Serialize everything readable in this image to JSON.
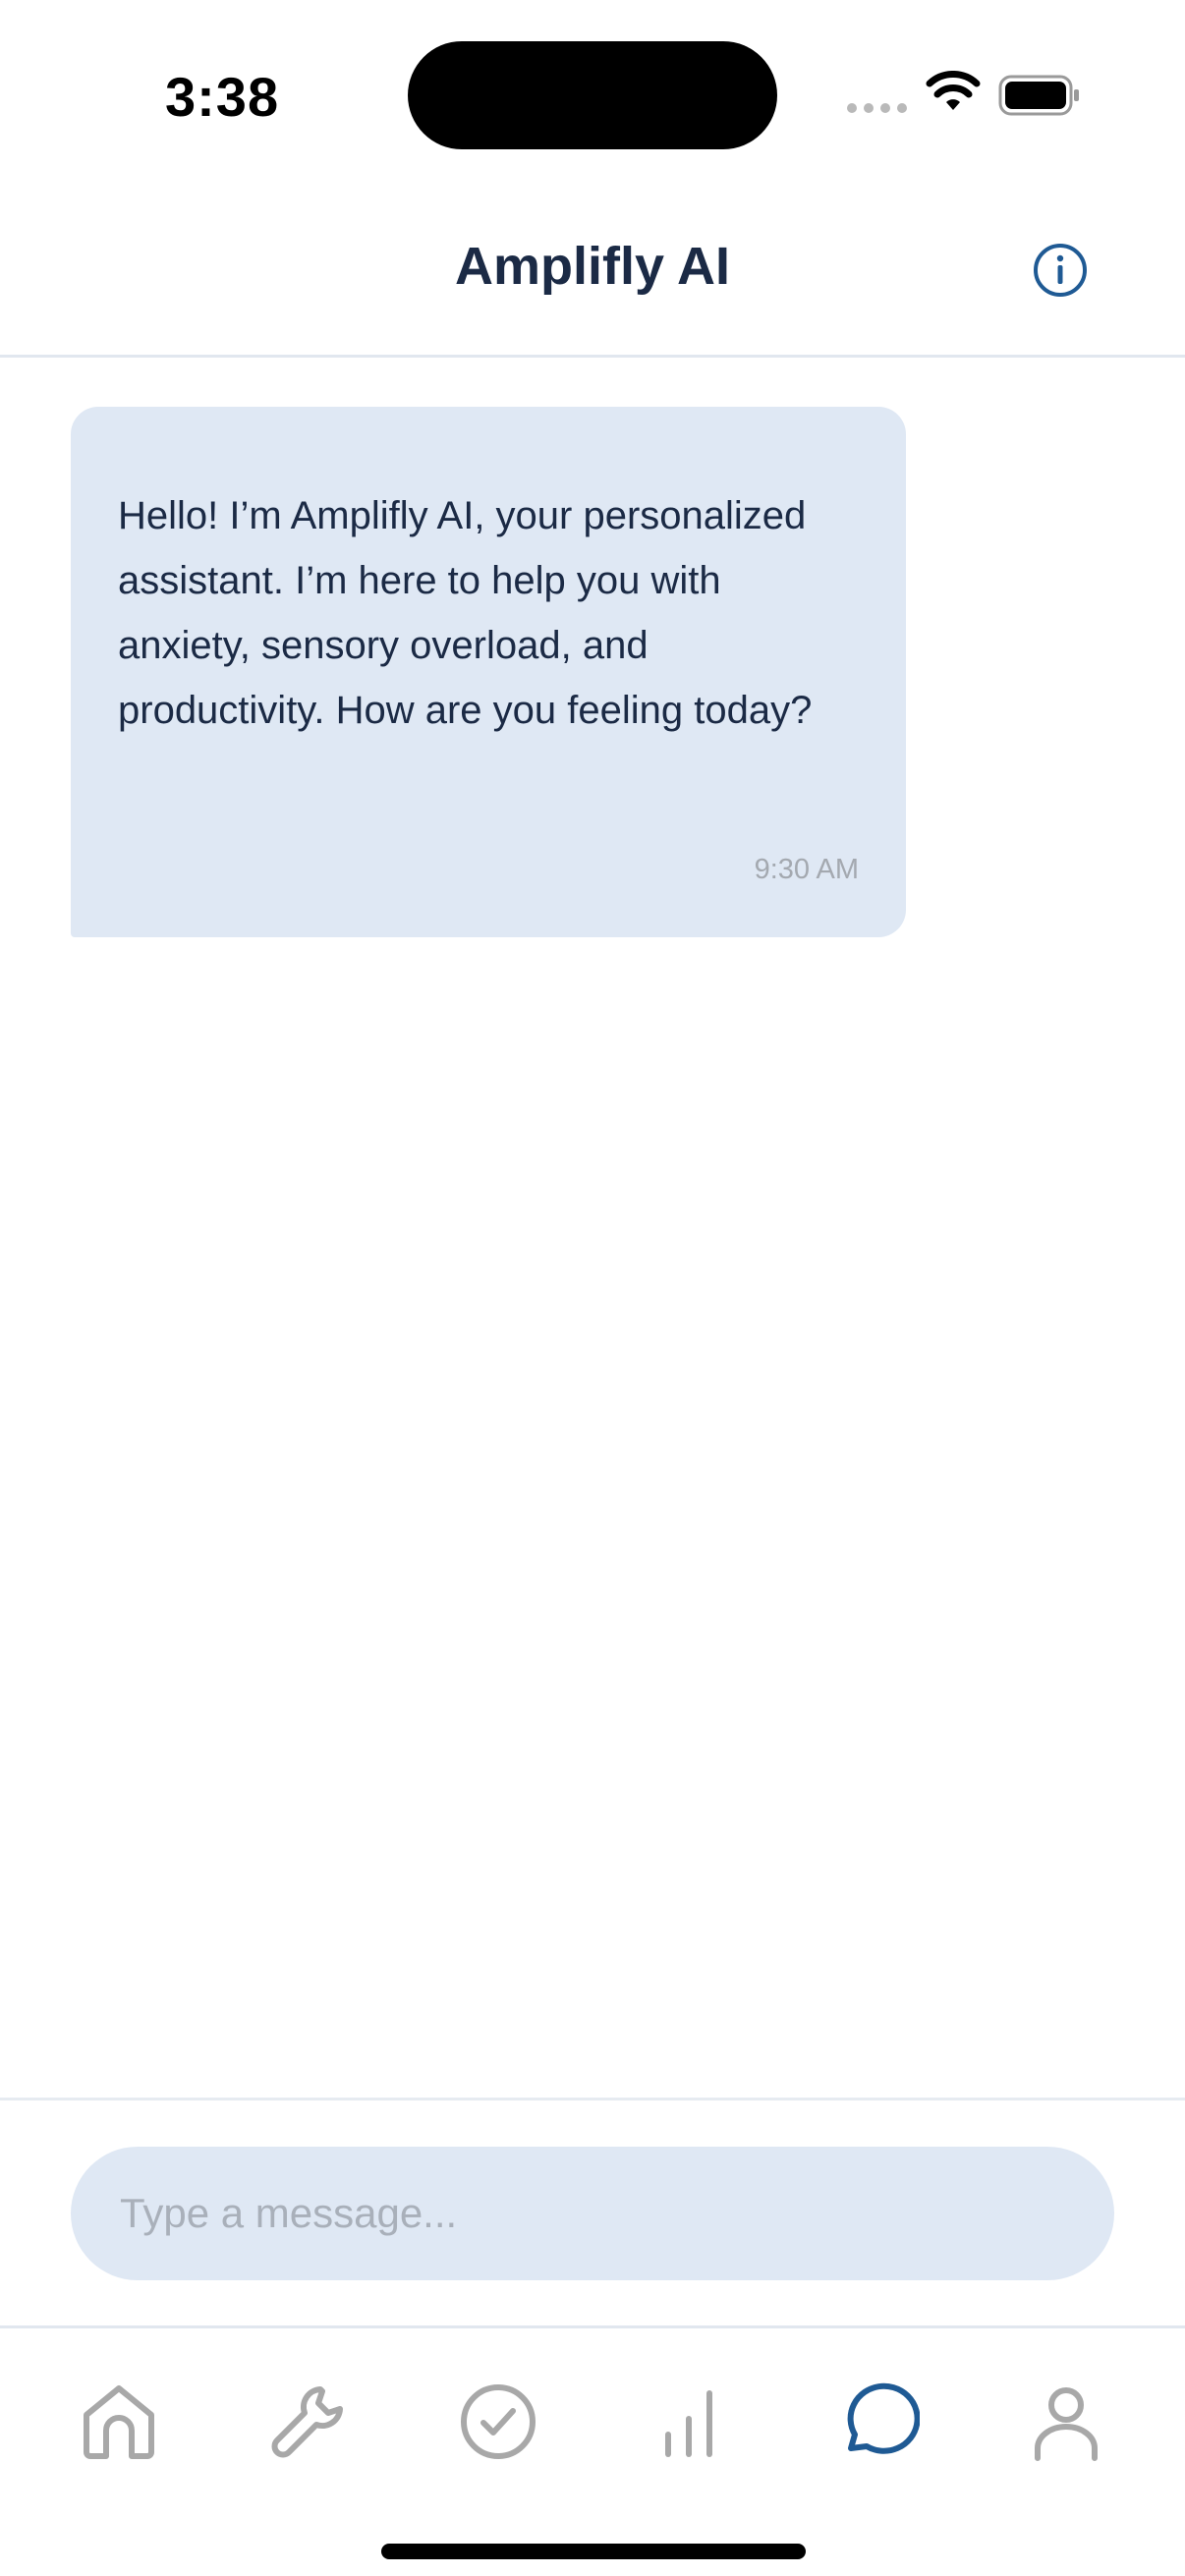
{
  "status_bar": {
    "time": "3:38"
  },
  "header": {
    "title": "Amplifly AI",
    "info_icon": "info-icon"
  },
  "messages": [
    {
      "sender": "assistant",
      "text": "Hello! I’m Amplifly AI, your personalized assistant. I’m here to help you with anxiety, sensory overload, and productivity. How are you feeling today?",
      "time": "9:30 AM"
    }
  ],
  "input": {
    "placeholder": "Type a message...",
    "value": ""
  },
  "tabs": [
    {
      "icon": "home-icon",
      "active": false
    },
    {
      "icon": "wrench-icon",
      "active": false
    },
    {
      "icon": "check-circle-icon",
      "active": false
    },
    {
      "icon": "bar-chart-icon",
      "active": false
    },
    {
      "icon": "chat-bubble-icon",
      "active": true
    },
    {
      "icon": "person-icon",
      "active": false
    }
  ],
  "colors": {
    "primary": "#1f5a94",
    "title_text": "#1b2a45",
    "bubble": "#dfe8f4",
    "inactive_icon": "#a8a8a8",
    "timestamp": "#a4a9b0"
  }
}
